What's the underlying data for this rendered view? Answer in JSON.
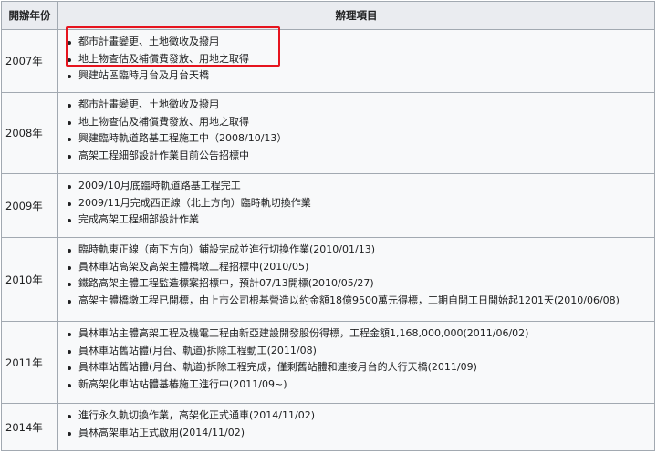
{
  "table": {
    "headers": {
      "year": "開辦年份",
      "items": "辦理項目"
    },
    "rows": [
      {
        "year": "2007年",
        "items": [
          "都市計畫變更、土地徵收及撥用",
          "地上物查估及補償費發放、用地之取得",
          "興建站區臨時月台及月台天橋"
        ]
      },
      {
        "year": "2008年",
        "items": [
          "都市計畫變更、土地徵收及撥用",
          "地上物查估及補償費發放、用地之取得",
          "興建臨時軌道路基工程施工中（2008/10/13）",
          "高架工程細部設計作業目前公告招標中"
        ]
      },
      {
        "year": "2009年",
        "items": [
          "2009/10月底臨時軌道路基工程完工",
          "2009/11月完成西正線（北上方向）臨時軌切換作業",
          "完成高架工程細部設計作業"
        ]
      },
      {
        "year": "2010年",
        "items": [
          "臨時軌東正線（南下方向）鋪設完成並進行切換作業(2010/01/13)",
          "員林車站高架及高架主體橋墩工程招標中(2010/05)",
          "鐵路高架主體工程監造標案招標中，預計07/13開標(2010/05/27)",
          "高架主體橋墩工程已開標，由上市公司根基營造以約金額18億9500萬元得標，工期自開工日開始起1201天(2010/06/08)"
        ]
      },
      {
        "year": "2011年",
        "items": [
          "員林車站主體高架工程及機電工程由新亞建設開發股份得標，工程金額1,168,000,000(2011/06/02)",
          "員林車站舊站體(月台、軌道)拆除工程動工(2011/08)",
          "員林車站舊站體(月台、軌道)拆除工程完成，僅剩舊站體和連接月台的人行天橋(2011/09)",
          "新高架化車站站體基樁施工進行中(2011/09~)"
        ]
      },
      {
        "year": "2014年",
        "items": [
          "進行永久軌切換作業，高架化正式通車(2014/11/02)",
          "員林高架車站正式啟用(2014/11/02)"
        ]
      }
    ]
  },
  "highlight": {
    "color": "#e6141e"
  }
}
